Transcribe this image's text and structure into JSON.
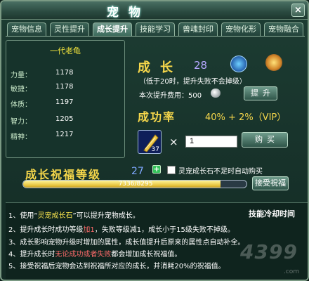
{
  "window": {
    "title": "宠物",
    "close_glyph": "×"
  },
  "tabs": [
    {
      "label": "宠物信息"
    },
    {
      "label": "灵性提升"
    },
    {
      "label": "成长提升"
    },
    {
      "label": "技能学习"
    },
    {
      "label": "兽魂封印"
    },
    {
      "label": "宠物化形"
    },
    {
      "label": "宠物融合"
    }
  ],
  "pet": {
    "name": "一代老龟",
    "stats": [
      {
        "label": "力量：",
        "value": "1178"
      },
      {
        "label": "敏捷：",
        "value": "1178"
      },
      {
        "label": "体质：",
        "value": "1197"
      },
      {
        "label": "智力：",
        "value": "1205"
      },
      {
        "label": "精神：",
        "value": "1217"
      }
    ]
  },
  "growth": {
    "label": "成长",
    "value": "28",
    "note": "（低于20时，提升失败不会掉级）",
    "cost_label": "本次提升费用：500",
    "refine_button": "提升",
    "rate_label": "成功率",
    "rate_value": "40% + 2%（VIP）",
    "stone_count": "37",
    "times": "×",
    "qty_value": "1",
    "buy_button": "购买"
  },
  "blessing": {
    "label": "成长祝福等级",
    "value": "27",
    "plus": "+",
    "auto_buy_label": "灵宠成长石不足时自动购买",
    "progress_text": "7336/8295",
    "progress_fraction": 0.884,
    "accept_button": "接受祝福"
  },
  "notes": {
    "cooldown": "技能冷却时间",
    "lines": [
      {
        "pre": "1、使用“",
        "mid": "灵宠成长石",
        "post": "”可以提升宠物成长。"
      },
      {
        "pre": "2、提升成长时成功等级",
        "mid": "加1",
        "post": "，失败等级减1，成长小于15级失败不掉级。"
      },
      {
        "pre": "3、成长影响宠物升级时增加的属性，成长值提升后原来的属性点自动补全。",
        "mid": "",
        "post": ""
      },
      {
        "pre": "4、提升成长时",
        "mid": "无论成功或者失败",
        "post": "都会增加成长祝福值。"
      },
      {
        "pre": "5、接受祝福后宠物会达到祝福所对应的成长，并消耗20%的祝福值。",
        "mid": "",
        "post": ""
      }
    ],
    "watermark": "4399",
    "watermark_sub": ".com"
  },
  "colors": {
    "accent_yellow": "#f7d84b",
    "progress_fill": "#e6c23a",
    "highlight_red": "#ff6b6b"
  }
}
